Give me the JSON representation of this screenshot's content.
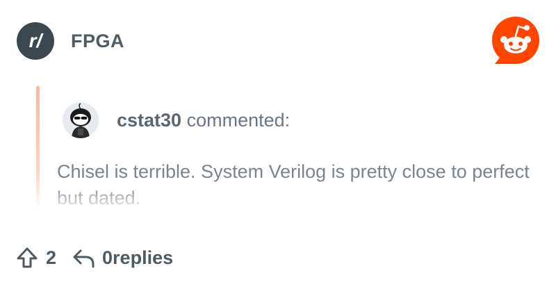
{
  "subreddit": {
    "icon": "subreddit-r-icon",
    "icon_text": "r/",
    "name": "FPGA"
  },
  "brand": {
    "logo": "reddit-snoo-icon",
    "color": "#ff4500"
  },
  "comment": {
    "author": "cstat30",
    "action": "commented:",
    "text": "Chisel is terrible. System Verilog is pretty close to perfect but dated."
  },
  "footer": {
    "upvote_icon": "upvote-arrow-icon",
    "upvotes": "2",
    "reply_icon": "reply-arrow-icon",
    "replies": "0replies"
  },
  "colors": {
    "quote_bar": "#f8b9a4",
    "text_gray": "#7a848c",
    "dark_gray": "#4e5a62"
  }
}
